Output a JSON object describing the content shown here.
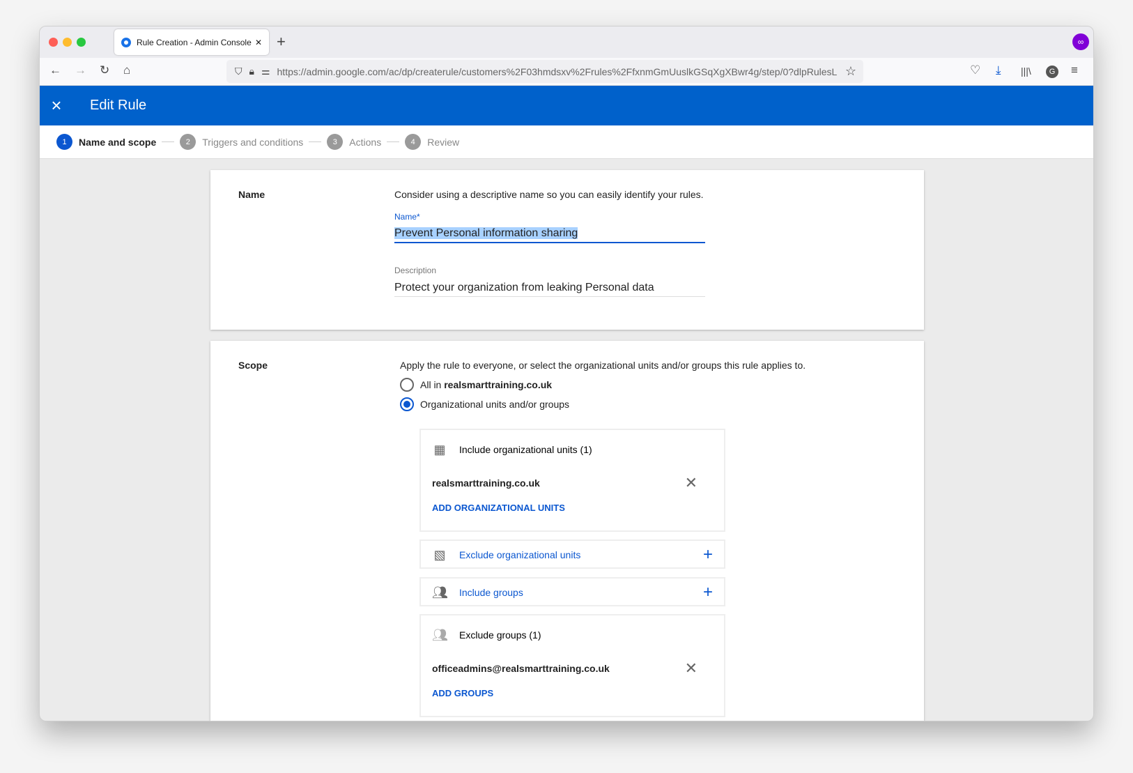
{
  "browser": {
    "tab_title": "Rule Creation - Admin Console",
    "url": "https://admin.google.com/ac/dp/createrule/customers%2F03hmdsxv%2Frules%2FfxnmGmUuslkGSqXgXBwr4g/step/0?dlpRulesL"
  },
  "header": {
    "title": "Edit Rule"
  },
  "steps": [
    {
      "num": "1",
      "label": "Name and scope"
    },
    {
      "num": "2",
      "label": "Triggers and conditions"
    },
    {
      "num": "3",
      "label": "Actions"
    },
    {
      "num": "4",
      "label": "Review"
    }
  ],
  "name_section": {
    "label": "Name",
    "hint": "Consider using a descriptive name so you can easily identify your rules.",
    "name_label": "Name*",
    "name_value": "Prevent Personal  information sharing",
    "desc_label": "Description",
    "desc_value": "Protect your organization from leaking Personal data"
  },
  "scope_section": {
    "label": "Scope",
    "hint": "Apply the rule to everyone, or select the organizational units and/or groups this rule applies to.",
    "opt_all_prefix": "All in ",
    "opt_all_domain": "realsmarttraining.co.uk",
    "opt_units": "Organizational units and/or groups",
    "include_ou": {
      "title": "Include organizational units (1)",
      "item": "realsmarttraining.co.uk",
      "add": "ADD ORGANIZATIONAL UNITS"
    },
    "exclude_ou": {
      "title": "Exclude organizational units"
    },
    "include_groups": {
      "title": "Include groups"
    },
    "exclude_groups": {
      "title": "Exclude groups (1)",
      "item": "officeadmins@realsmarttraining.co.uk",
      "add": "ADD GROUPS"
    }
  }
}
